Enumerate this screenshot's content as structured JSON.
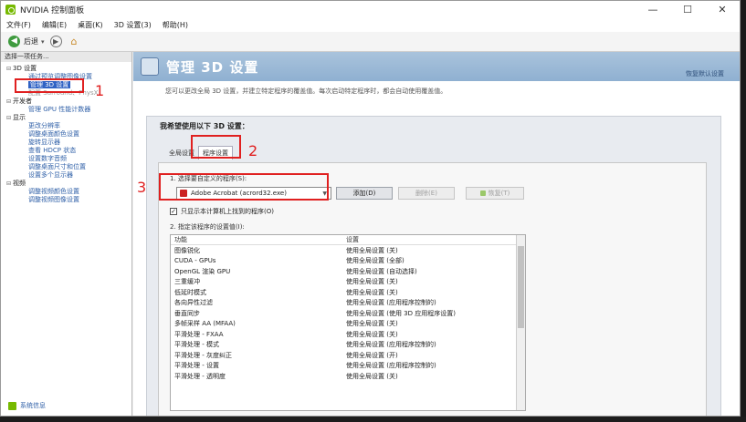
{
  "window": {
    "title": "NVIDIA 控制面板",
    "minimize": "—",
    "maximize": "☐",
    "close": "✕"
  },
  "menu": [
    "文件(F)",
    "编辑(E)",
    "桌面(K)",
    "3D 设置(3)",
    "帮助(H)"
  ],
  "toolbar": {
    "back_label": "后退"
  },
  "sidebar": {
    "header": "选择一项任务...",
    "tree": [
      {
        "label": "3D 设置",
        "level": 0,
        "expander": "⊟"
      },
      {
        "label": "通过预览调整图像设置",
        "level": 1
      },
      {
        "label": "管理 3D 设置",
        "level": 1,
        "selected": true
      },
      {
        "label": "配置 Surround、PhysX",
        "level": 1,
        "faded": true
      },
      {
        "label": "开发者",
        "level": 0,
        "expander": "⊟"
      },
      {
        "label": "管理 GPU 性能计数器",
        "level": 1
      },
      {
        "label": "显示",
        "level": 0,
        "expander": "⊟"
      },
      {
        "label": "更改分辨率",
        "level": 1
      },
      {
        "label": "调整桌面颜色设置",
        "level": 1
      },
      {
        "label": "旋转显示器",
        "level": 1
      },
      {
        "label": "查看 HDCP 状态",
        "level": 1
      },
      {
        "label": "设置数字音频",
        "level": 1
      },
      {
        "label": "调整桌面尺寸和位置",
        "level": 1
      },
      {
        "label": "设置多个显示器",
        "level": 1
      },
      {
        "label": "视频",
        "level": 0,
        "expander": "⊟"
      },
      {
        "label": "调整视频颜色设置",
        "level": 1
      },
      {
        "label": "调整视频图像设置",
        "level": 1
      }
    ],
    "footer": "系统信息"
  },
  "main": {
    "title": "管理 3D 设置",
    "restore": "恢复默认设置",
    "description": "您可以更改全局 3D 设置，并建立特定程序的覆盖值。每次启动特定程序时，都会自动使用覆盖值。",
    "heading": "我希望使用以下 3D 设置：",
    "tabs": [
      "全局设置",
      "程序设置"
    ],
    "step1": "1. 选择要自定义的程序(S):",
    "program": "Adobe Acrobat (acrord32.exe)",
    "add_button": "添加(D)",
    "delete_button": "删除(E)",
    "restore_button": "恢复(T)",
    "checkbox_label": "只显示本计算机上找到的程序(O)",
    "checkbox_mark": "✓",
    "step2": "2. 指定该程序的设置值(I):",
    "table": {
      "headers": [
        "功能",
        "设置"
      ],
      "rows": [
        [
          "图像锐化",
          "使用全局设置 (关)"
        ],
        [
          "CUDA - GPUs",
          "使用全局设置 (全部)"
        ],
        [
          "OpenGL 渲染 GPU",
          "使用全局设置 (自动选择)"
        ],
        [
          "三重缓冲",
          "使用全局设置 (关)"
        ],
        [
          "低延时模式",
          "使用全局设置 (关)"
        ],
        [
          "各向异性过滤",
          "使用全局设置 (应用程序控制的)"
        ],
        [
          "垂直同步",
          "使用全局设置 (使用 3D 应用程序设置)"
        ],
        [
          "多帧采样 AA (MFAA)",
          "使用全局设置 (关)"
        ],
        [
          "平滑处理 - FXAA",
          "使用全局设置 (关)"
        ],
        [
          "平滑处理 - 模式",
          "使用全局设置 (应用程序控制的)"
        ],
        [
          "平滑处理 - 灰度纠正",
          "使用全局设置 (开)"
        ],
        [
          "平滑处理 - 设置",
          "使用全局设置 (应用程序控制的)"
        ],
        [
          "平滑处理 - 透明度",
          "使用全局设置 (关)"
        ]
      ]
    }
  },
  "annotations": [
    "1",
    "2",
    "3"
  ],
  "colors": {
    "accent_red": "#e02020",
    "nvidia_green": "#76b900",
    "banner_blue": "#9ab8d6",
    "selection": "#2f62c4"
  }
}
